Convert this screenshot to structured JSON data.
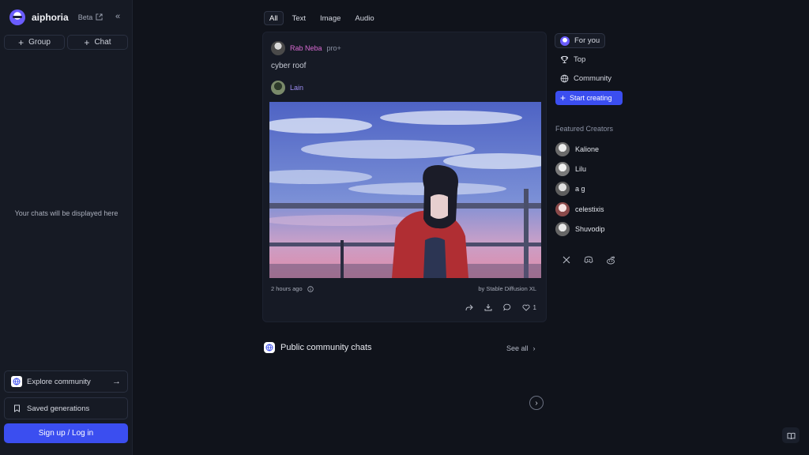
{
  "brand": {
    "name": "aiphoria",
    "badge": "Beta"
  },
  "sidebar": {
    "group_label": "Group",
    "chat_label": "Chat",
    "empty_text": "Your chats will be displayed here",
    "explore_label": "Explore community",
    "saved_label": "Saved generations",
    "signup_label": "Sign up / Log in"
  },
  "tabs": [
    {
      "label": "All",
      "active": true
    },
    {
      "label": "Text",
      "active": false
    },
    {
      "label": "Image",
      "active": false
    },
    {
      "label": "Audio",
      "active": false
    }
  ],
  "post": {
    "author": "Rab Neba",
    "author_badge": "pro+",
    "prompt": "cyber roof",
    "reply_author": "Lain",
    "timestamp": "2 hours ago",
    "model": "by Stable Diffusion XL",
    "like_count": "1"
  },
  "community": {
    "title": "Public community chats",
    "see_all": "See all"
  },
  "right_nav": {
    "for_you": "For you",
    "top": "Top",
    "community": "Community",
    "start_creating": "Start creating"
  },
  "featured": {
    "title": "Featured Creators",
    "creators": [
      "Kalione",
      "Lilu",
      "a g",
      "celestixis",
      "Shuvodip"
    ]
  },
  "colors": {
    "accent": "#3b4ef0",
    "author": "#d86ad2",
    "reply": "#9b8cf0"
  }
}
